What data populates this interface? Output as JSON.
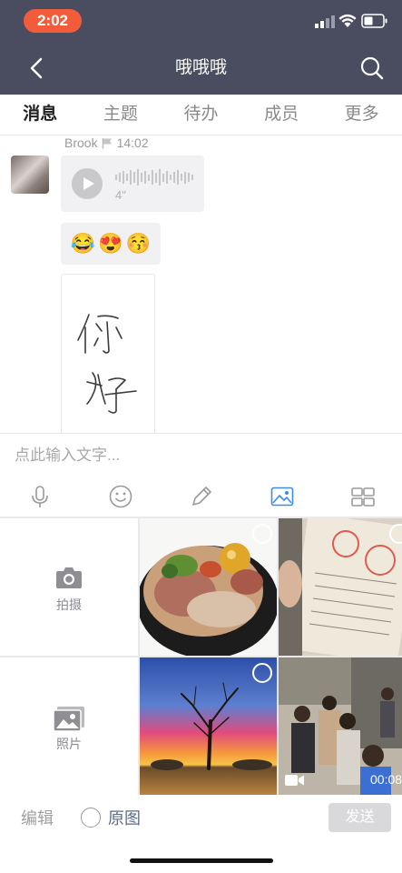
{
  "status_bar": {
    "time": "2:02"
  },
  "nav": {
    "title": "哦哦哦"
  },
  "tabs": [
    {
      "label": "消息",
      "active": true
    },
    {
      "label": "主题",
      "active": false
    },
    {
      "label": "待办",
      "active": false
    },
    {
      "label": "成员",
      "active": false
    },
    {
      "label": "更多",
      "active": false
    }
  ],
  "message": {
    "sender": "Brook",
    "time": "14:02",
    "voice_duration": "4\"",
    "emojis": [
      "😂",
      "😍",
      "😚"
    ]
  },
  "input": {
    "placeholder": "点此输入文字..."
  },
  "toolbar": {
    "icons": [
      "mic-icon",
      "emoji-icon",
      "pen-icon",
      "image-icon",
      "grid-icon"
    ],
    "active": "image-icon",
    "accent": "#3a8ee6"
  },
  "picker": {
    "camera_label": "拍摄",
    "album_label": "照片",
    "video_duration": "00:08"
  },
  "bottom": {
    "edit_label": "编辑",
    "original_label": "原图",
    "send_label": "发送"
  }
}
